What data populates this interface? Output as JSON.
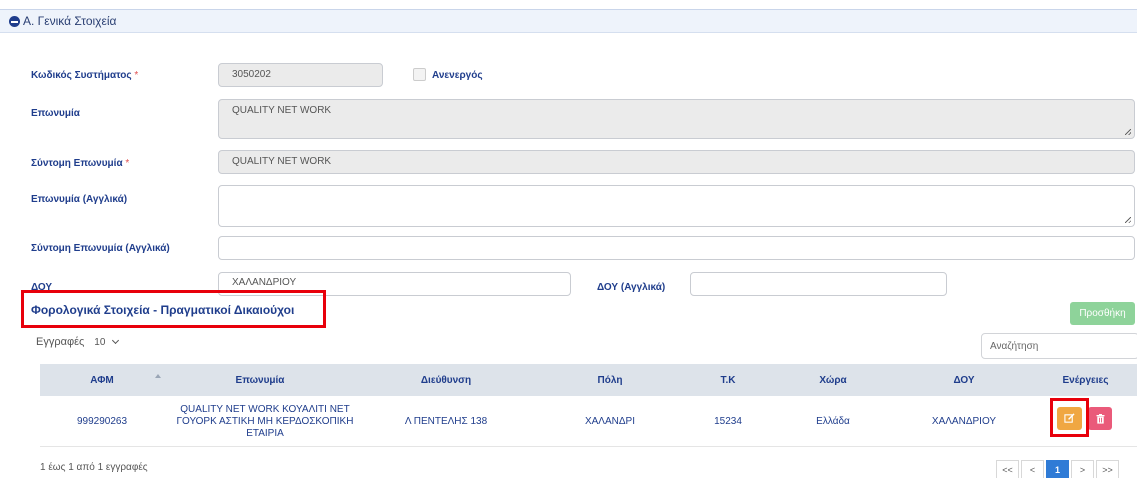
{
  "section": {
    "title": "Α. Γενικά Στοιχεία"
  },
  "form": {
    "system_code": {
      "label": "Κωδικός Συστήματος",
      "required_mark": "*",
      "value": "3050202"
    },
    "inactive": {
      "label": "Ανενεργός",
      "checked": false
    },
    "name": {
      "label": "Επωνυμία",
      "value": "QUALITY NET WORK"
    },
    "short_name": {
      "label": "Σύντομη Επωνυμία",
      "required_mark": "*",
      "value": "QUALITY NET WORK"
    },
    "name_en": {
      "label": "Επωνυμία (Αγγλικά)",
      "value": ""
    },
    "short_name_en": {
      "label": "Σύντομη Επωνυμία (Αγγλικά)",
      "value": ""
    },
    "doy": {
      "label": "ΔΟΥ",
      "value": "ΧΑΛΑΝΔΡΙΟΥ"
    },
    "doy_en": {
      "label": "ΔΟΥ (Αγγλικά)",
      "value": ""
    }
  },
  "tax_section": {
    "title": "Φορολογικά Στοιχεία - Πραγματικοί Δικαιούχοι",
    "add_button": "Προσθήκη",
    "entries_label": "Εγγραφές",
    "entries_value": "10",
    "search_placeholder": "Αναζήτηση"
  },
  "table": {
    "headers": [
      "ΑΦΜ",
      "Επωνυμία",
      "Διεύθυνση",
      "Πόλη",
      "Τ.Κ",
      "Χώρα",
      "ΔΟΥ",
      "Ενέργειες"
    ],
    "rows": [
      {
        "afm": "999290263",
        "name": "QUALITY NET WORK ΚΟΥΑΛΙΤΙ ΝΕΤ ΓΟΥΟΡΚ ΑΣΤΙΚΗ ΜΗ ΚΕΡΔΟΣΚΟΠΙΚΗ ΕΤΑΙΡΙΑ",
        "address": "Λ ΠΕΝΤΕΛΗΣ 138",
        "city": "ΧΑΛΑΝΔΡΙ",
        "postal_code": "15234",
        "country": "Ελλάδα",
        "doy": "ΧΑΛΑΝΔΡΙΟΥ"
      }
    ]
  },
  "footer": {
    "info": "1 έως 1 από 1 εγγραφές",
    "pager": [
      "<<",
      "<",
      "1",
      ">",
      ">>"
    ]
  },
  "colors": {
    "accent": "#1f3d8c",
    "highlight": "#e8000b",
    "edit": "#f0a742",
    "delete": "#ea5a7a",
    "add": "#8ed39a",
    "active_page": "#2f7bd6"
  }
}
